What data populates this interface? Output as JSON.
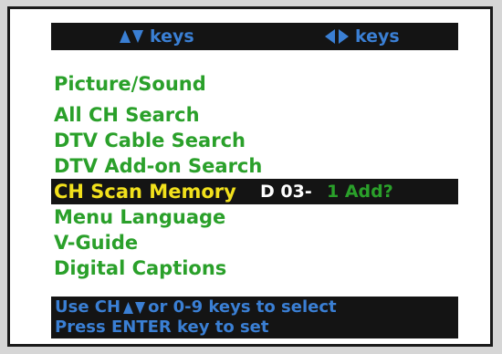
{
  "header": {
    "updown_keys_label": "keys",
    "leftright_keys_label": "keys"
  },
  "menu": {
    "items": [
      {
        "label": "Picture/Sound"
      },
      {
        "label": "All CH Search"
      },
      {
        "label": "DTV Cable Search"
      },
      {
        "label": "DTV Add-on Search"
      },
      {
        "label": "CH Scan Memory",
        "channel": "D 03-",
        "action": "1 Add?"
      },
      {
        "label": "Menu Language"
      },
      {
        "label": "V-Guide"
      },
      {
        "label": "Digital Captions"
      }
    ],
    "selected_index": 4
  },
  "help": {
    "line1_prefix": "Use CH",
    "line1_suffix": "or 0-9 keys to select",
    "line2": "Press ENTER key to set"
  },
  "colors": {
    "menu_text": "#2aa02a",
    "selected_text": "#f2e11c",
    "hint_text": "#3a7fd4",
    "bar_background": "#141414",
    "screen_background": "#ffffff"
  },
  "icons": {
    "updown": "up-down-arrows-icon",
    "leftright": "left-right-arrows-icon"
  }
}
